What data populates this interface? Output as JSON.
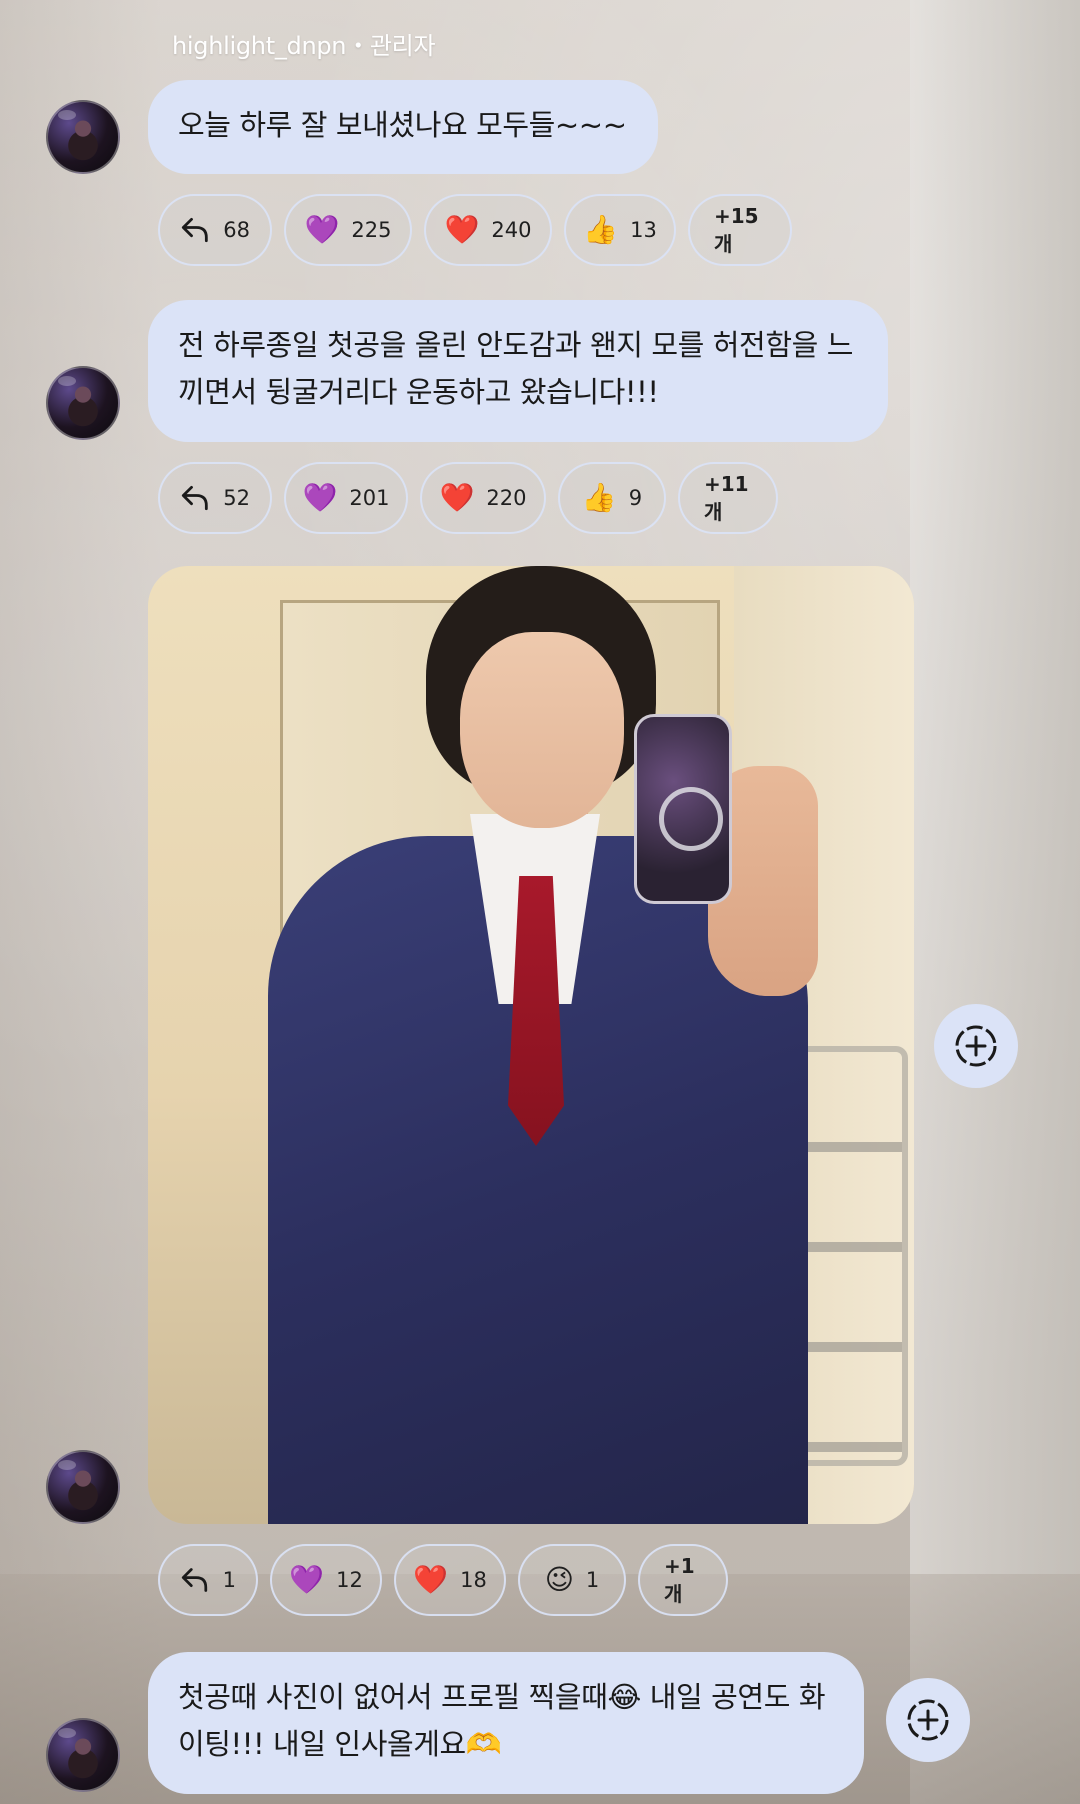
{
  "author": {
    "name_label": "highlight_dnpn・관리자"
  },
  "messages": [
    {
      "text": "오늘 하루 잘 보내셨나요 모두들~~~",
      "reactions": {
        "replies": "68",
        "purple_heart": "225",
        "red_heart": "240",
        "thumbs_up": "13",
        "more": "+15개"
      }
    },
    {
      "text": "전 하루종일 첫공을 올린 안도감과 왠지 모를 허전함을 느끼면서 뒹굴거리다 운동하고 왔습니다!!!",
      "reactions": {
        "replies": "52",
        "purple_heart": "201",
        "red_heart": "220",
        "thumbs_up": "9",
        "more": "+11개"
      }
    },
    {
      "type": "photo",
      "reactions": {
        "replies": "1",
        "purple_heart": "12",
        "red_heart": "18",
        "wink": "1",
        "more": "+1개"
      }
    },
    {
      "text": "첫공때 사진이 없어서 프로필 찍을때😂 내일 공연도 화이팅!!! 내일 인사올게요🫶"
    }
  ],
  "emoji": {
    "purple_heart": "💜",
    "red_heart": "❤️",
    "thumbs_up": "👍",
    "wink": "😉"
  },
  "colors": {
    "bubble": "#dbe3f7",
    "label": "#ffffff",
    "text": "#1a1a1a"
  },
  "icons": {
    "reply": "reply-arrow-icon",
    "add": "add-reaction-icon",
    "avatar": "user-avatar"
  }
}
